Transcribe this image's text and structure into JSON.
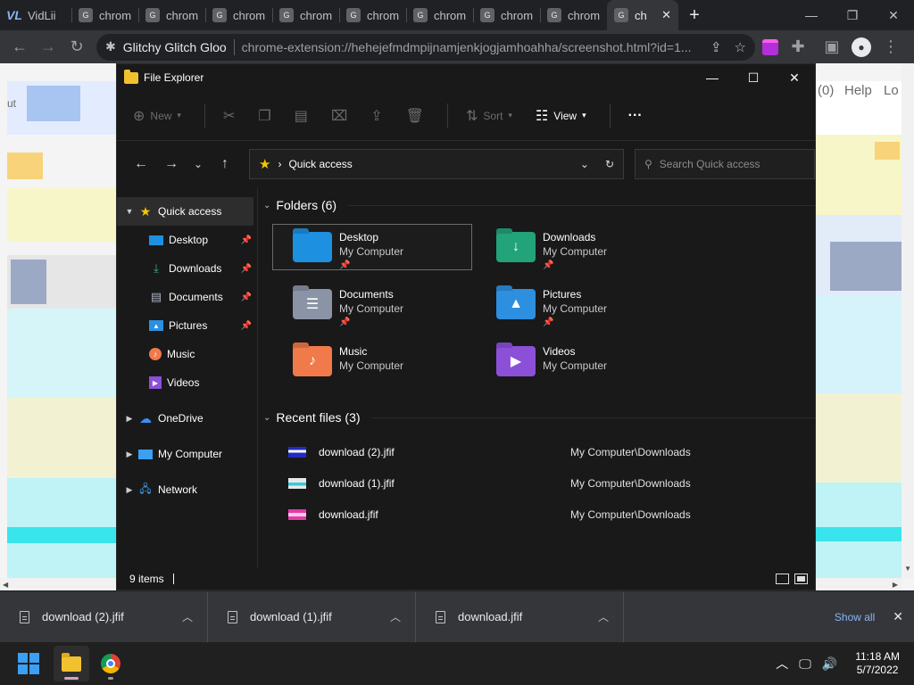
{
  "browser": {
    "tabs": [
      {
        "icon": "VL",
        "title": "VidLii"
      },
      {
        "icon": "G",
        "title": "chrom"
      },
      {
        "icon": "G",
        "title": "chrom"
      },
      {
        "icon": "G",
        "title": "chrom"
      },
      {
        "icon": "G",
        "title": "chrom"
      },
      {
        "icon": "G",
        "title": "chrom"
      },
      {
        "icon": "G",
        "title": "chrom"
      },
      {
        "icon": "G",
        "title": "chrom"
      },
      {
        "icon": "G",
        "title": "chrom"
      },
      {
        "icon": "G",
        "title": "ch",
        "active": true
      }
    ],
    "new_tab": "+",
    "window_controls": {
      "minimize": "—",
      "restore": "❐",
      "close": "✕"
    },
    "omnibox": {
      "site_name": "Glitchy Glitch Gloo",
      "url": "chrome-extension://hehejefmdmpijnamjenkjogjamhoahha/screenshot.html?id=1..."
    }
  },
  "page_bg": {
    "text_right_1": "(0)",
    "text_right_2": "Help",
    "text_right_3": "Lo",
    "text_left": "ut"
  },
  "explorer": {
    "title": "File Explorer",
    "controls": {
      "minimize": "—",
      "maximize": "☐",
      "close": "✕"
    },
    "commands": {
      "new": "New",
      "sort": "Sort",
      "view": "View",
      "more": "···"
    },
    "address": {
      "location": "Quick access",
      "separator": "›"
    },
    "search_placeholder": "Search Quick access",
    "sidebar": {
      "quick_access": "Quick access",
      "pinned": [
        {
          "label": "Desktop",
          "icon": "desktop-icon",
          "pinned": true
        },
        {
          "label": "Downloads",
          "icon": "download-icon",
          "pinned": true
        },
        {
          "label": "Documents",
          "icon": "document-icon",
          "pinned": true
        },
        {
          "label": "Pictures",
          "icon": "picture-icon",
          "pinned": true
        },
        {
          "label": "Music",
          "icon": "music-icon",
          "pinned": false
        },
        {
          "label": "Videos",
          "icon": "video-icon",
          "pinned": false
        }
      ],
      "onedrive": "OneDrive",
      "my_computer": "My Computer",
      "network": "Network"
    },
    "folders_heading": "Folders (6)",
    "folders": [
      {
        "name": "Desktop",
        "location": "My Computer",
        "pinned": true,
        "color": "#1e90e0",
        "glyph": ""
      },
      {
        "name": "Downloads",
        "location": "My Computer",
        "pinned": true,
        "color": "#22a37a",
        "glyph": "↓"
      },
      {
        "name": "Documents",
        "location": "My Computer",
        "pinned": true,
        "color": "#8b93a6",
        "glyph": "☰"
      },
      {
        "name": "Pictures",
        "location": "My Computer",
        "pinned": true,
        "color": "#2d8fe0",
        "glyph": "▲"
      },
      {
        "name": "Music",
        "location": "My Computer",
        "pinned": false,
        "color": "#f07a4a",
        "glyph": "♪"
      },
      {
        "name": "Videos",
        "location": "My Computer",
        "pinned": false,
        "color": "#8c4fd8",
        "glyph": "▶"
      }
    ],
    "recent_heading": "Recent files (3)",
    "recent": [
      {
        "name": "download (2).jfif",
        "location": "My Computer\\Downloads"
      },
      {
        "name": "download (1).jfif",
        "location": "My Computer\\Downloads"
      },
      {
        "name": "download.jfif",
        "location": "My Computer\\Downloads"
      }
    ],
    "status": "9 items"
  },
  "downloads_shelf": {
    "items": [
      {
        "name": "download (2).jfif"
      },
      {
        "name": "download (1).jfif"
      },
      {
        "name": "download.jfif"
      }
    ],
    "show_all": "Show all",
    "close": "✕"
  },
  "taskbar": {
    "time": "11:18 AM",
    "date": "5/7/2022"
  }
}
